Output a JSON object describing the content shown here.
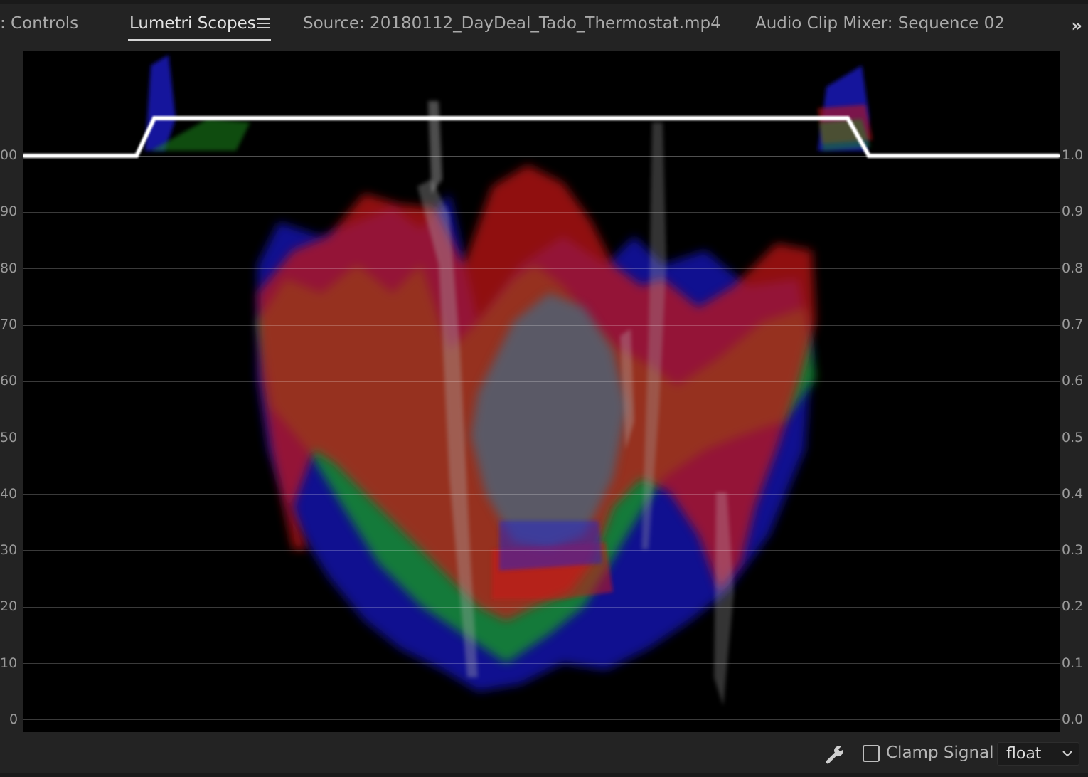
{
  "tabs": [
    {
      "label": ": Controls",
      "active": false
    },
    {
      "label": "Lumetri Scopes",
      "active": true
    },
    {
      "label": "Source: 20180112_DayDeal_Tado_Thermostat.mp4",
      "active": false
    },
    {
      "label": "Audio Clip Mixer: Sequence 02",
      "active": false
    }
  ],
  "icons": {
    "panel_menu": "hamburger-menu-icon",
    "overflow": "double-chevron-right-icon",
    "settings": "wrench-icon",
    "dropdown": "chevron-down-icon"
  },
  "scope": {
    "type": "RGB parade/waveform",
    "left_scale": [
      "00",
      "90",
      "80",
      "70",
      "60",
      "50",
      "40",
      "30",
      "20",
      "10",
      "0"
    ],
    "right_scale": [
      "1.0",
      "0.9",
      "0.8",
      "0.7",
      "0.6",
      "0.5",
      "0.4",
      "0.3",
      "0.2",
      "0.1",
      "0.0"
    ]
  },
  "footer": {
    "clamp_label": "Clamp Signal",
    "clamp_checked": false,
    "precision_value": "float"
  },
  "colors": {
    "red": "#d01818",
    "green": "#1aa81a",
    "blue": "#1a1ad0",
    "panel_bg": "#232323"
  }
}
